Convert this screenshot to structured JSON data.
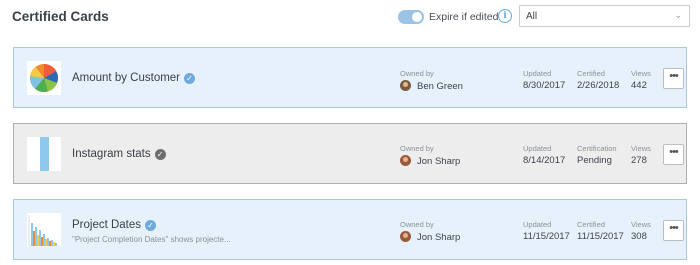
{
  "header": {
    "title": "Certified Cards",
    "toggle_label": "Expire if edited",
    "toggle_on": true,
    "select_value": "All"
  },
  "cards": [
    {
      "name": "Amount by Customer",
      "description": "",
      "owner_label": "Owned by",
      "owner": "Ben Green",
      "updated_label": "Updated",
      "updated": "8/30/2017",
      "cert_label": "Certified",
      "cert": "2/26/2018",
      "views_label": "Views",
      "views": "442",
      "style": "blue"
    },
    {
      "name": "Instagram stats",
      "description": "",
      "owner_label": "Owned by",
      "owner": "Jon Sharp",
      "updated_label": "Updated",
      "updated": "8/14/2017",
      "cert_label": "Certification",
      "cert": "Pending",
      "views_label": "Views",
      "views": "278",
      "style": "gray"
    },
    {
      "name": "Project Dates",
      "description": "\"Project Completion Dates\" shows projecte...",
      "owner_label": "Owned by",
      "owner": "Jon Sharp",
      "updated_label": "Updated",
      "updated": "11/15/2017",
      "cert_label": "Certified",
      "cert": "11/15/2017",
      "views_label": "Views",
      "views": "308",
      "style": "blue"
    }
  ],
  "more_icon": "ellipsis-icon",
  "colors": {
    "accent": "#6fa9dd",
    "card_blue_bg": "#e6f1fb",
    "card_gray_bg": "#ededed"
  }
}
